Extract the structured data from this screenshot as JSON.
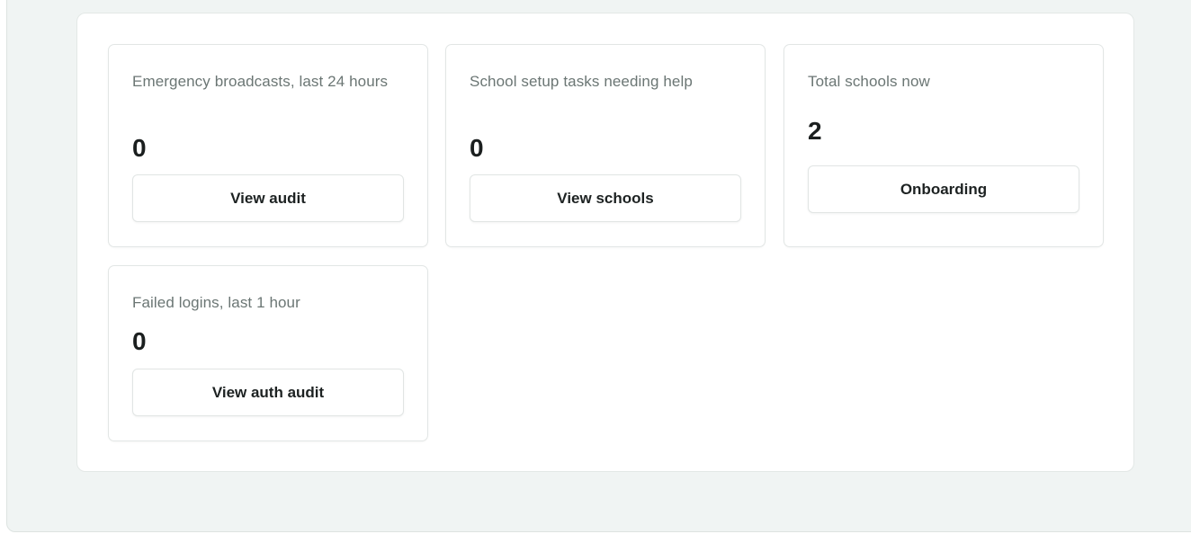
{
  "cards": [
    {
      "label": "Emergency broadcasts, last 24 hours",
      "value": "0",
      "button_label": "View audit"
    },
    {
      "label": "School setup tasks needing help",
      "value": "0",
      "button_label": "View schools"
    },
    {
      "label": "Total schools now",
      "value": "2",
      "button_label": "Onboarding"
    },
    {
      "label": "Failed logins, last 1 hour",
      "value": "0",
      "button_label": "View auth audit"
    }
  ]
}
